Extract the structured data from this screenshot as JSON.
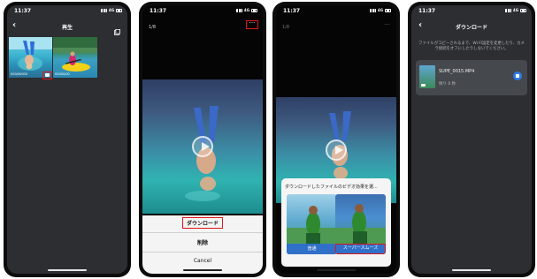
{
  "status": {
    "time": "11:37",
    "network": "4G"
  },
  "screen1": {
    "title": "再生",
    "thumb1_label": "000/00000",
    "thumb2_label": "00000/00"
  },
  "screen2": {
    "counter": "1/8",
    "menu": [
      "ダウンロード",
      "削除",
      "Cancel"
    ]
  },
  "screen3": {
    "counter": "1/8",
    "dialog_title": "ダウンロードしたファイルのビデオ効果を選...",
    "options": [
      {
        "label": "普通"
      },
      {
        "label": "スーパースムーズ"
      }
    ]
  },
  "screen4": {
    "title": "ダウンロード",
    "info": "ファイルがコピーされるまで、Wi-Fi設定を変更したり、カメラ接続をオフにしたりしないでください。",
    "file": {
      "name": "SUPE_0015.MP4",
      "remaining": "残り 0 秒"
    }
  },
  "colors": {
    "highlight": "#e0161a",
    "accent": "#3070c9"
  },
  "icons": [
    "back-icon",
    "download-icon",
    "more-icon",
    "play-icon",
    "video-icon",
    "stop-icon"
  ]
}
